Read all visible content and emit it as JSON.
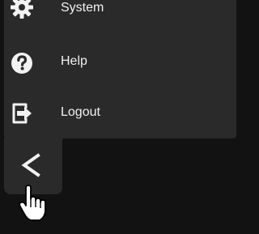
{
  "menu": {
    "items": [
      {
        "label": "System",
        "icon": "gear-icon"
      },
      {
        "label": "Help",
        "icon": "question-circle-icon"
      },
      {
        "label": "Logout",
        "icon": "logout-icon"
      }
    ]
  },
  "collapse": {
    "icon": "chevron-left-icon"
  },
  "cursor": {
    "icon": "hand-pointer-icon"
  },
  "colors": {
    "background": "#121212",
    "panel": "#2a2a2a",
    "text": "#f2f2f2"
  }
}
